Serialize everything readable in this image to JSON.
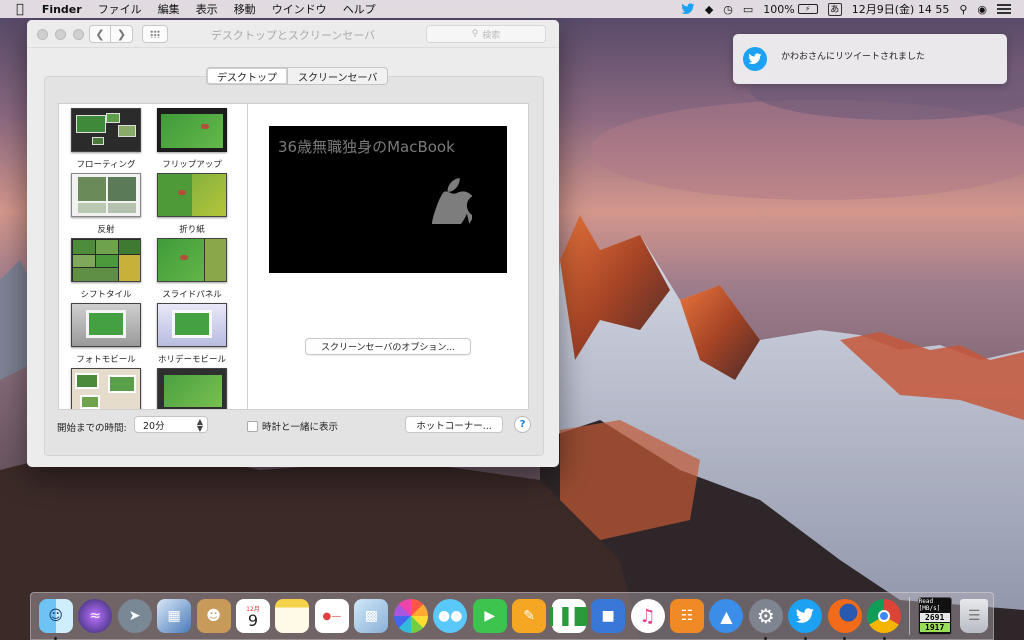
{
  "menubar": {
    "apple": "",
    "app_name": "Finder",
    "menus": [
      "ファイル",
      "編集",
      "表示",
      "移動",
      "ウインドウ",
      "ヘルプ"
    ],
    "battery_text": "100%",
    "ime": "あ",
    "date_time": "12月9日(金)  14 55"
  },
  "notification": {
    "text": "かわおさんにリツイートされました",
    "icon": "twitter-icon"
  },
  "window": {
    "title": "デスクトップとスクリーンセーバ",
    "search_placeholder": "検索",
    "tabs": [
      {
        "label": "デスクトップ",
        "selected": true
      },
      {
        "label": "スクリーンセーバ",
        "selected": false
      }
    ],
    "savers": [
      {
        "label": "フローティング"
      },
      {
        "label": "フリップアップ"
      },
      {
        "label": "反射"
      },
      {
        "label": "折り紙"
      },
      {
        "label": "シフトタイル"
      },
      {
        "label": "スライドパネル"
      },
      {
        "label": "フォトモビール"
      },
      {
        "label": "ホリデーモビール"
      },
      {
        "label": ""
      },
      {
        "label": ""
      }
    ],
    "preview_text": "36歳無職独身のMacBook",
    "options_button": "スクリーンセーバのオプション...",
    "start_label": "開始までの時間:",
    "start_value": "20分",
    "show_clock_label": "時計と一緒に表示",
    "hot_corners_button": "ホットコーナー...",
    "help_button": "?"
  },
  "dock": {
    "read_label": "Read [MB/s]",
    "read_value1": "2691",
    "read_value2": "1917",
    "calendar_month": "12月",
    "calendar_day": "9"
  }
}
